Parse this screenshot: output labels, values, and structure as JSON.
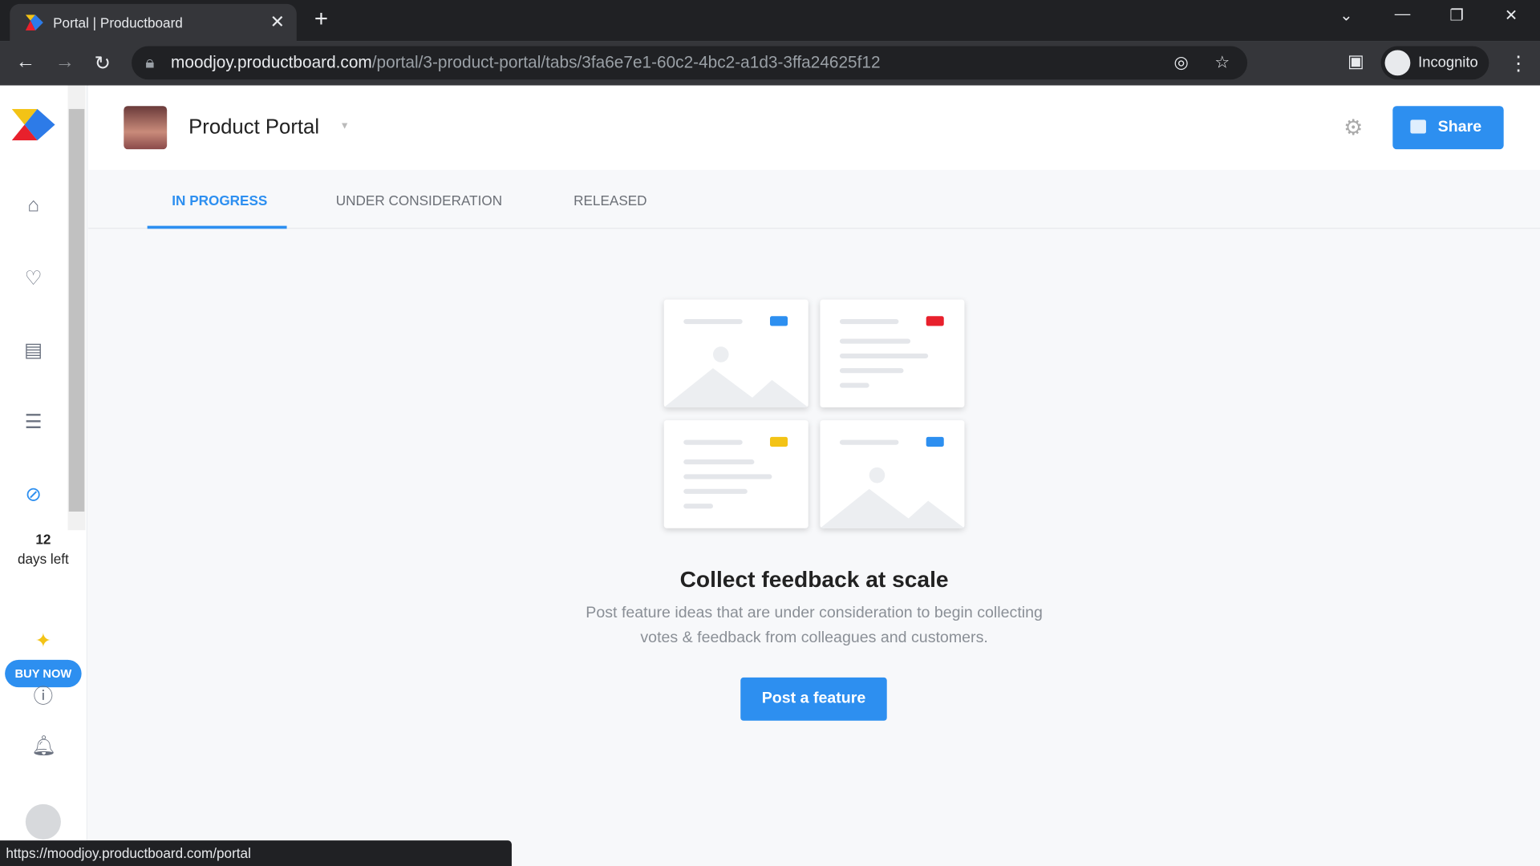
{
  "browser": {
    "tab_title": "Portal | Productboard",
    "url_host": "moodjoy.productboard.com",
    "url_path": "/portal/3-product-portal/tabs/3fa6e7e1-60c2-4bc2-a1d3-3ffa24625f12",
    "profile": "Incognito",
    "status_url": "https://moodjoy.productboard.com/portal"
  },
  "sidebar": {
    "trial_days": "12",
    "trial_label": "days left",
    "buy_label": "BUY NOW",
    "icons": [
      "home-icon",
      "lightbulb-icon",
      "notes-icon",
      "roadmap-icon",
      "portal-icon",
      "sparkle-icon",
      "help-icon",
      "bell-icon",
      "user-avatar"
    ]
  },
  "header": {
    "title": "Product Portal",
    "share_label": "Share"
  },
  "tabs": [
    {
      "label": "IN PROGRESS",
      "active": true
    },
    {
      "label": "UNDER CONSIDERATION",
      "active": false
    },
    {
      "label": "RELEASED",
      "active": false
    }
  ],
  "empty": {
    "title": "Collect feedback at scale",
    "line1": "Post feature ideas that are under consideration to begin collecting",
    "line2": "votes & feedback from colleagues and customers.",
    "button": "Post a feature"
  },
  "colors": {
    "accent": "#2d8ff0",
    "tag_blue": "#2d8ff0",
    "tag_red": "#e8202c",
    "tag_yellow": "#f3c316"
  }
}
